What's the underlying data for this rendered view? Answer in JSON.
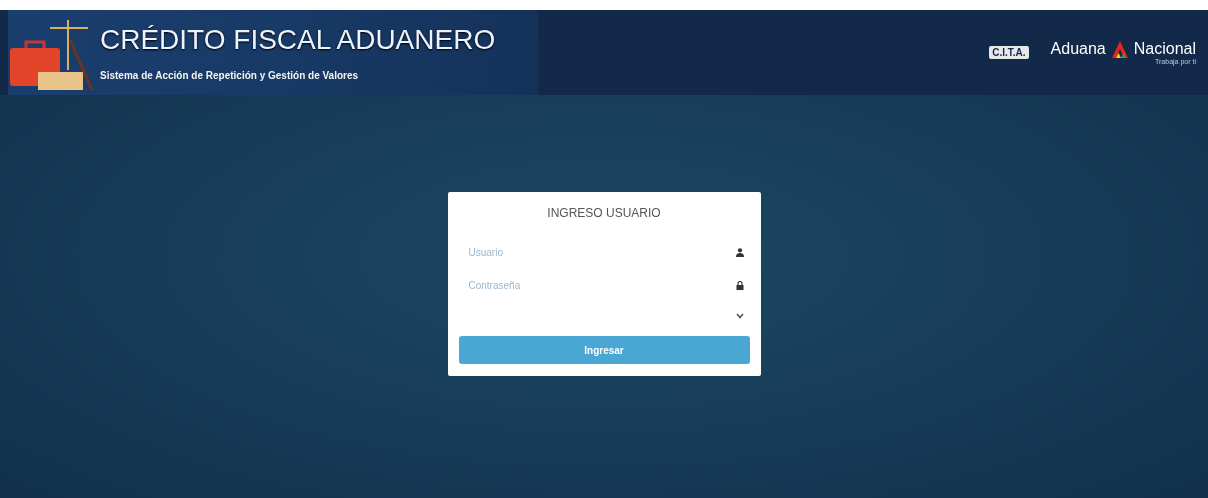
{
  "banner": {
    "title": "CRÉDITO FISCAL ADUANERO",
    "subtitle": "Sistema de Acción de Repetición y Gestión de Valores"
  },
  "logos": {
    "cita": "C.I.T.A.",
    "aduana_left": "Aduana",
    "aduana_right": "Nacional",
    "tagline": "Trabaja por ti"
  },
  "login": {
    "title": "INGRESO USUARIO",
    "fields": [
      {
        "kind": "text",
        "placeholder": "Usuario"
      },
      {
        "kind": "password",
        "placeholder": "Contraseña"
      },
      {
        "kind": "select"
      }
    ],
    "button": "Ingresar"
  }
}
